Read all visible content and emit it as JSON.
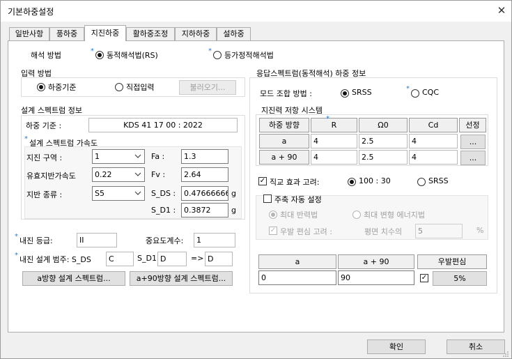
{
  "window": {
    "title": "기본하중설정"
  },
  "tabs": [
    "일반사항",
    "풍하중",
    "지진하중",
    "활하중조정",
    "지하하중",
    "설하중"
  ],
  "analysis": {
    "label": "해석 방법",
    "opt1": "동적해석법(RS)",
    "opt2": "등가정적해석법"
  },
  "input_method": {
    "title": "입력 방법",
    "opt1": "하중기준",
    "opt2": "직접입력",
    "load_button": "불러오기..."
  },
  "spectrum_info": {
    "title": "설계 스펙트럼 정보",
    "load_std_label": "하중 기준 :",
    "load_std_value": "KDS 41 17 00 : 2022",
    "accel_title": "설계 스펙트럼 가속도",
    "zone_label": "지진 구역 :",
    "zone_value": "1",
    "pga_label": "유효지반가속도",
    "pga_value": "0.22",
    "soil_label": "지반 종류 :",
    "soil_value": "S5",
    "fa_label": "Fa :",
    "fa_value": "1.3",
    "fv_label": "Fv :",
    "fv_value": "2.64",
    "sds_label": "S_DS :",
    "sds_value": "0.476666667",
    "sd1_label": "S_D1 :",
    "sd1_value": "0.3872",
    "unit_g": "g"
  },
  "seismic_grade": {
    "label": "내진 등급:",
    "value": "II",
    "importance_label": "중요도계수:",
    "importance_value": "1"
  },
  "seismic_category": {
    "label": "내진 설계 범주: S_DS",
    "sds_value": "C",
    "sd1_label": "S_D1",
    "sd1_value": "D",
    "arrow": "=>",
    "result_value": "D"
  },
  "spectrum_buttons": {
    "a": "a방향 설계 스펙트럼...",
    "a90": "a+90방향 설계 스펙트럼..."
  },
  "response": {
    "title": "응답스펙트럼(동적해석) 하중 정보",
    "mode_label": "모드 조합 방법 :",
    "mode_opt1": "SRSS",
    "mode_opt2": "CQC",
    "system_title": "지진력 저항 시스템",
    "table_headers": [
      "하중 방향",
      "R",
      "Ω0",
      "Cd",
      "선정"
    ],
    "rows": [
      {
        "dir": "a",
        "R": "4",
        "O": "2.5",
        "Cd": "4",
        "pick": "..."
      },
      {
        "dir": "a + 90",
        "R": "4",
        "O": "2.5",
        "Cd": "4",
        "pick": "..."
      }
    ],
    "ortho_label": "직교 효과 고려:",
    "ortho_opt1": "100 : 30",
    "ortho_opt2": "SRSS",
    "main_axis_label": "주축 자동 설정",
    "max_reaction": "최대 반력법",
    "max_energy": "최대 변형 에너지법",
    "eccentric_label": "우발 편심 고려 :",
    "plan_dim_label": "평면 치수의",
    "plan_dim_value": "5",
    "percent": "%",
    "angle_headers": [
      "a",
      "a + 90",
      "우발편심"
    ],
    "angle_a": "0",
    "angle_a90": "90",
    "eccentric_button": "5%"
  },
  "footer": {
    "ok": "확인",
    "cancel": "취소"
  }
}
